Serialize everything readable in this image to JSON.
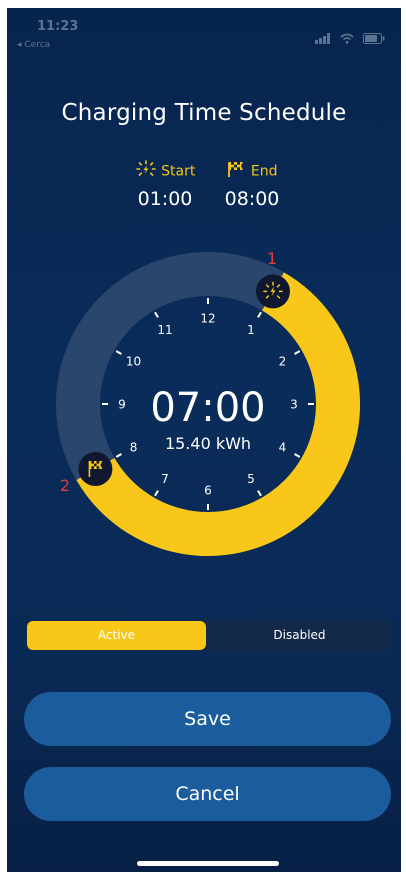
{
  "status_bar": {
    "time": "11:23",
    "back_label": "◂ Cerca",
    "icons": [
      "signal-icon",
      "wifi-icon",
      "battery-icon"
    ]
  },
  "title": "Charging Time Schedule",
  "start": {
    "label": "Start",
    "value": "01:00",
    "icon": "sun-charging-icon"
  },
  "end": {
    "label": "End",
    "value": "08:00",
    "icon": "checkered-flag-icon"
  },
  "dial": {
    "duration": "07:00",
    "energy": "15.40 kWh",
    "hours": [
      "12",
      "1",
      "2",
      "3",
      "4",
      "5",
      "6",
      "7",
      "8",
      "9",
      "10",
      "11"
    ],
    "start_pin_number": "1",
    "end_pin_number": "2",
    "active_color": "#f8c71a",
    "track_color": "#2a466d"
  },
  "toggle": {
    "active_label": "Active",
    "disabled_label": "Disabled",
    "selected": "Active"
  },
  "buttons": {
    "save": "Save",
    "cancel": "Cancel"
  },
  "colors": {
    "accent": "#f8c71a",
    "button": "#1b5c9c",
    "background": "#0a2c5a",
    "pin_number": "#e8393b"
  }
}
